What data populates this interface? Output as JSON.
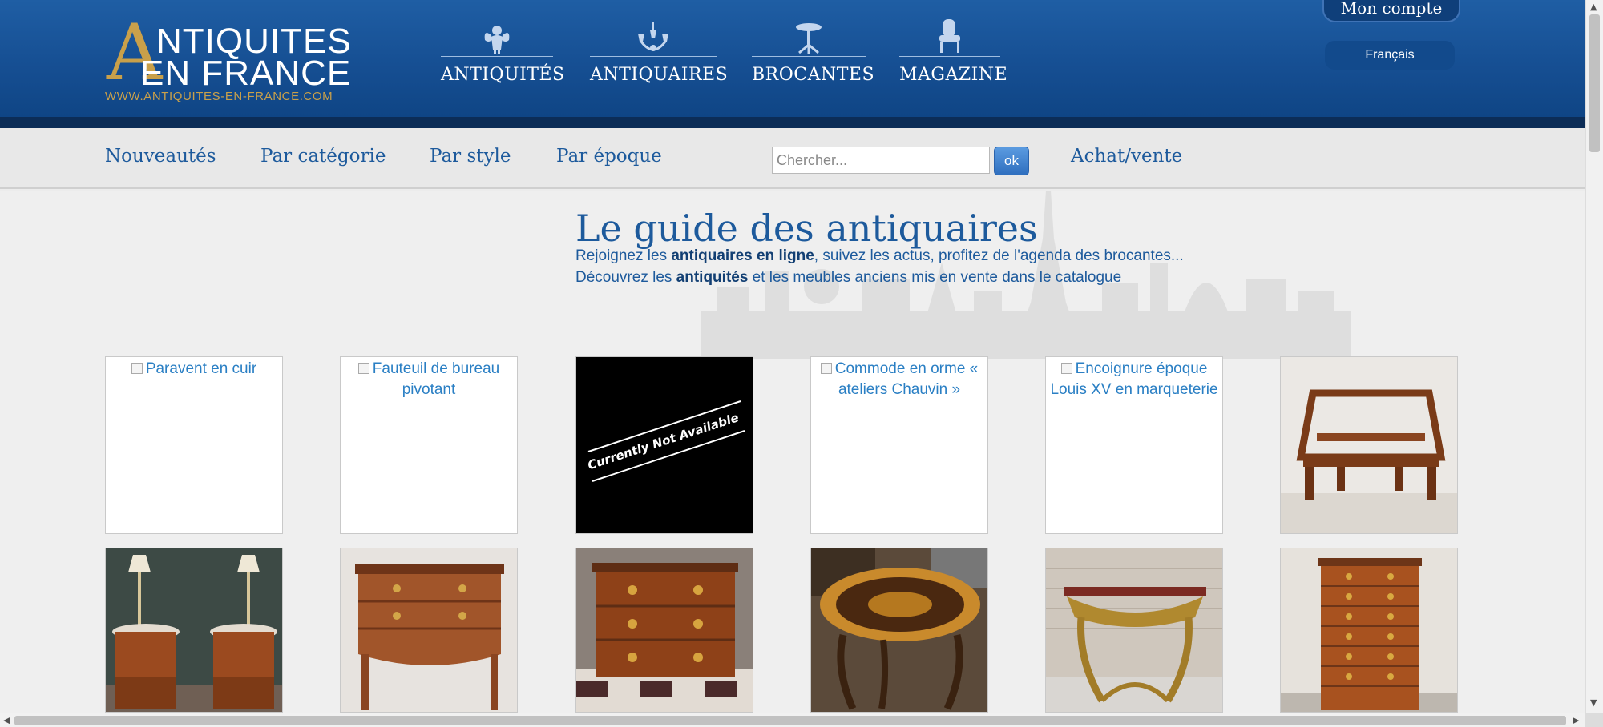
{
  "header": {
    "logo": {
      "first_letter": "A",
      "line1": "NTIQUITES",
      "line2": "EN FRANCE",
      "url": "WWW.ANTIQUITES-EN-FRANCE.COM"
    },
    "main_nav": [
      {
        "label": "ANTIQUITÉS",
        "icon": "cherub-icon"
      },
      {
        "label": "ANTIQUAIRES",
        "icon": "chandelier-icon"
      },
      {
        "label": "BROCANTES",
        "icon": "pedestal-table-icon"
      },
      {
        "label": "MAGAZINE",
        "icon": "armchair-icon"
      }
    ],
    "account_label": "Mon compte",
    "language": "Français"
  },
  "subnav": {
    "links": [
      "Nouveautés",
      "Par catégorie",
      "Par style",
      "Par époque"
    ],
    "search_placeholder": "Chercher...",
    "search_button": "ok",
    "trade_link": "Achat/vente"
  },
  "hero": {
    "title": "Le guide des antiquaires",
    "line1_before": "Rejoignez les ",
    "line1_bold": "antiquaires en ligne",
    "line1_after": ", suivez les actus, profitez de l'agenda des brocantes...",
    "line2_before": "Découvrez les ",
    "line2_bold": "antiquités",
    "line2_after": " et les meubles anciens mis en vente dans le catalogue"
  },
  "products_row1": [
    {
      "alt": "Paravent en cuir",
      "kind": "broken"
    },
    {
      "alt": "Fauteuil de bureau pivotant",
      "kind": "broken"
    },
    {
      "alt": "Currently Not Available",
      "kind": "unavailable"
    },
    {
      "alt": "Commode en orme « ateliers Chauvin »",
      "kind": "broken"
    },
    {
      "alt": "Encoignure époque Louis XV en marqueterie",
      "kind": "broken"
    },
    {
      "alt": "book-stand-photo",
      "kind": "photo"
    }
  ],
  "products_row2": [
    {
      "alt": "bedside-tables-photo",
      "kind": "photo"
    },
    {
      "alt": "small-commode-photo",
      "kind": "photo"
    },
    {
      "alt": "marquetry-commode-photo",
      "kind": "photo"
    },
    {
      "alt": "marquetry-table-photo",
      "kind": "photo"
    },
    {
      "alt": "gilded-console-photo",
      "kind": "photo"
    },
    {
      "alt": "chiffonnier-photo",
      "kind": "photo"
    }
  ],
  "colors": {
    "header_blue": "#164f93",
    "gold": "#c9a04a",
    "link_blue": "#1d5a9c",
    "alt_blue": "#2a7fc4"
  }
}
